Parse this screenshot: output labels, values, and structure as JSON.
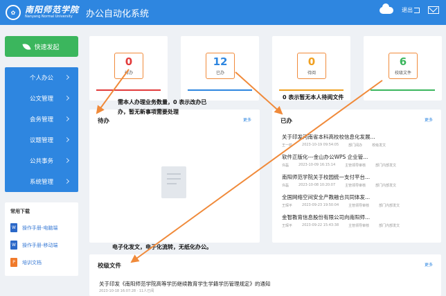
{
  "header": {
    "logo_cn": "南阳师范学院",
    "logo_en": "Nanyang Normal University",
    "app_title": "办公自动化系统",
    "logout_label": "退出"
  },
  "quick_button": "快速发起",
  "nav": [
    {
      "label": "个人办公"
    },
    {
      "label": "公文管理"
    },
    {
      "label": "会务管理"
    },
    {
      "label": "议题管理"
    },
    {
      "label": "公共事务"
    },
    {
      "label": "系统管理"
    }
  ],
  "downloads": {
    "title": "常用下载",
    "items": [
      {
        "label": "操作手册-电脑端",
        "icon": "W"
      },
      {
        "label": "操作手册-移动端",
        "icon": "W"
      },
      {
        "label": "培训文档",
        "icon": "P"
      }
    ]
  },
  "stats": [
    {
      "value": "0",
      "label": "待办",
      "color": "#e23b3b",
      "bar": "#e23b3b"
    },
    {
      "value": "12",
      "label": "已办",
      "color": "#2e86e0",
      "bar": "#2e86e0"
    },
    {
      "value": "0",
      "label": "待阅",
      "color": "#f0a020",
      "bar": "#f0a020"
    },
    {
      "value": "6",
      "label": "校级文件",
      "color": "#3bb65d",
      "bar": "#3bb65d"
    }
  ],
  "todo_panel": {
    "title": "待办",
    "more": "更多"
  },
  "done_panel": {
    "title": "已办",
    "more": "更多",
    "items": [
      {
        "title": "关于印发河南省本科高校校信息化发展...",
        "who": "王一鸣",
        "time": "2023-10-19 09:54:05",
        "status": "部门阅办",
        "kind": "校级发文"
      },
      {
        "title": "软件正版化---金山办公WPS 企业管...",
        "who": "许磊",
        "time": "2023-10-09 16:15:14",
        "status": "主管领导审核",
        "kind": "部门内部发文"
      },
      {
        "title": "南阳师范学院关于校园统一支付平台...",
        "who": "许磊",
        "time": "2023-10-08 10:20:07",
        "status": "主管领导审核",
        "kind": "部门内部发文"
      },
      {
        "title": "全国网络空间安全产教融合共同体发...",
        "who": "王琛平",
        "time": "2023-09-23 19:50:04",
        "status": "主管领导审核",
        "kind": "部门内部发文"
      },
      {
        "title": "金智教育信息股份有限公司向南阳师...",
        "who": "王琛平",
        "time": "2023-09-22 15:43:38",
        "status": "主管领导审核",
        "kind": "部门内部发文"
      }
    ]
  },
  "files_panel": {
    "title": "校级文件",
    "more": "更多",
    "item_title": "关于印发《南阳师范学院高等学历继续教育学生学籍学历管理规定》的通知",
    "item_meta": "2023-10-18 16:07:28 · 11人已阅"
  },
  "annotations": {
    "a1_line1": "需本人办理业务数量，0 表示改办已",
    "a1_line2": "办，暂无新事项需要处理",
    "a2": "0 表示暂无本人待阅文件",
    "a3": "电子化发文，电子化流转，无纸化办公。"
  },
  "colors": {
    "primary": "#2e86e0",
    "green": "#3bb65d",
    "arrow": "#f08a3a"
  }
}
